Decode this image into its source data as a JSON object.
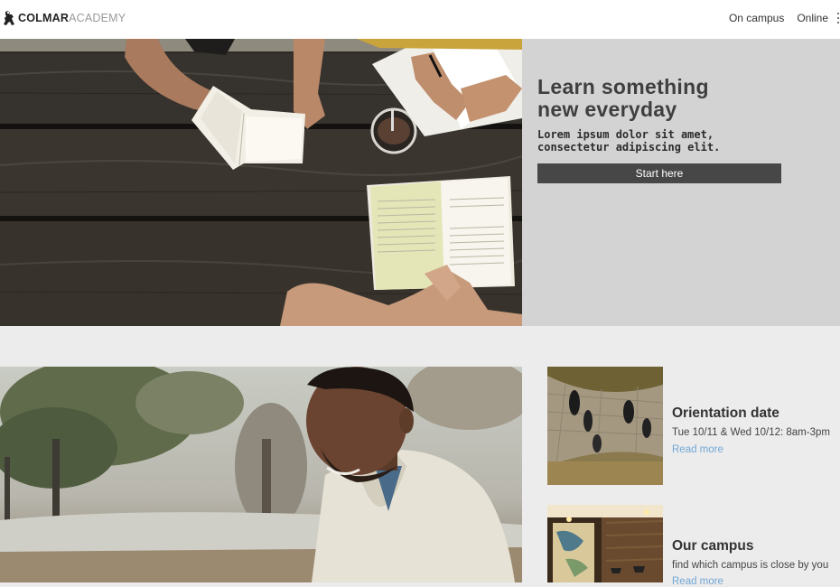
{
  "header": {
    "logo_primary": "COLMAR",
    "logo_secondary": "ACADEMY",
    "nav": [
      "On campus",
      "Online"
    ]
  },
  "hero": {
    "title": "Learn something new everyday",
    "subtitle": "Lorem ipsum dolor sit amet, consectetur adipiscing elit.",
    "button_label": "Start here"
  },
  "cards": [
    {
      "title": "Orientation date",
      "text": "Tue 10/11 & Wed 10/12: 8am-3pm",
      "link": "Read more"
    },
    {
      "title": "Our campus",
      "text": "find which campus is close by you",
      "link": "Read more"
    }
  ],
  "colors": {
    "panel_bg": "#d3d3d3",
    "button_bg": "#474747",
    "link": "#72a7d6",
    "page_bg": "#ececec"
  }
}
